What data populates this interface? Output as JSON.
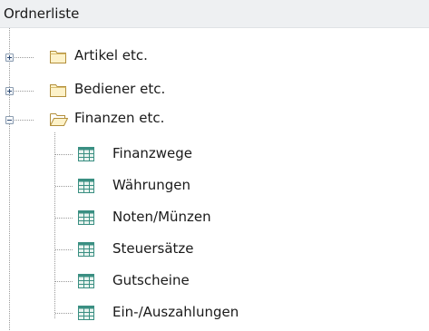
{
  "header": {
    "title": "Ordnerliste"
  },
  "tree": {
    "nodes": [
      {
        "label": "Artikel etc.",
        "state": "collapsed",
        "icon": "folder-closed-icon"
      },
      {
        "label": "Bediener etc.",
        "state": "collapsed",
        "icon": "folder-closed-icon"
      },
      {
        "label": "Finanzen etc.",
        "state": "expanded",
        "icon": "folder-open-icon",
        "children": [
          {
            "label": "Finanzwege",
            "icon": "table-icon"
          },
          {
            "label": "Währungen",
            "icon": "table-icon"
          },
          {
            "label": "Noten/Münzen",
            "icon": "table-icon"
          },
          {
            "label": "Steuersätze",
            "icon": "table-icon"
          },
          {
            "label": "Gutscheine",
            "icon": "table-icon"
          },
          {
            "label": "Ein-/Auszahlungen",
            "icon": "table-icon"
          }
        ]
      }
    ]
  },
  "colors": {
    "header_bg": "#eef0f2",
    "folder_fill": "#fdf2c9",
    "folder_stroke": "#b38f3b",
    "table_grid": "#3a8f82",
    "tree_lines": "#9a9a9a"
  }
}
